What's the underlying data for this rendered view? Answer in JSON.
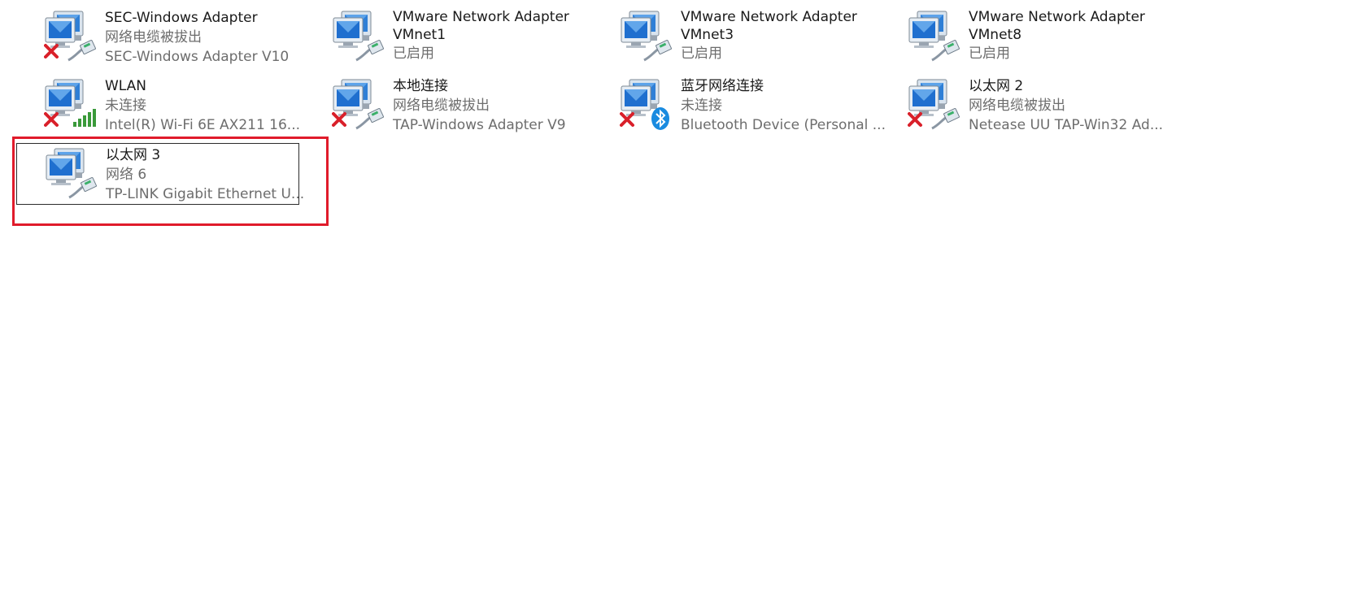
{
  "adapters": [
    {
      "name": "SEC-Windows Adapter",
      "status": "网络电缆被拔出",
      "device": "SEC-Windows Adapter V10",
      "badge": "x",
      "icon": "ethernet-cable-icon"
    },
    {
      "name": "VMware Network Adapter VMnet1",
      "status": "已启用",
      "device": "",
      "badge": "none",
      "icon": "ethernet-cable-icon"
    },
    {
      "name": "VMware Network Adapter VMnet3",
      "status": "已启用",
      "device": "",
      "badge": "none",
      "icon": "ethernet-cable-icon"
    },
    {
      "name": "VMware Network Adapter VMnet8",
      "status": "已启用",
      "device": "",
      "badge": "none",
      "icon": "ethernet-cable-icon"
    },
    {
      "name": "WLAN",
      "status": "未连接",
      "device": "Intel(R) Wi-Fi 6E AX211 16...",
      "badge": "x",
      "icon": "signal-bars-icon"
    },
    {
      "name": "本地连接",
      "status": "网络电缆被拔出",
      "device": "TAP-Windows Adapter V9",
      "badge": "x",
      "icon": "ethernet-cable-icon"
    },
    {
      "name": "蓝牙网络连接",
      "status": "未连接",
      "device": "Bluetooth Device (Personal ...",
      "badge": "x",
      "icon": "bluetooth-icon"
    },
    {
      "name": "以太网 2",
      "status": "网络电缆被拔出",
      "device": "Netease UU TAP-Win32 Ad...",
      "badge": "x",
      "icon": "ethernet-cable-icon"
    },
    {
      "name": "以太网 3",
      "status": "网络 6",
      "device": "TP-LINK Gigabit Ethernet U...",
      "badge": "none",
      "icon": "ethernet-cable-icon",
      "selected": true
    }
  ],
  "colors": {
    "highlight": "#e01b2b",
    "status_text": "#6d6d6d",
    "name_text": "#1a1a1a",
    "error_x": "#d9202a",
    "signal": "#3a9a3a",
    "bluetooth": "#1a8be0"
  }
}
